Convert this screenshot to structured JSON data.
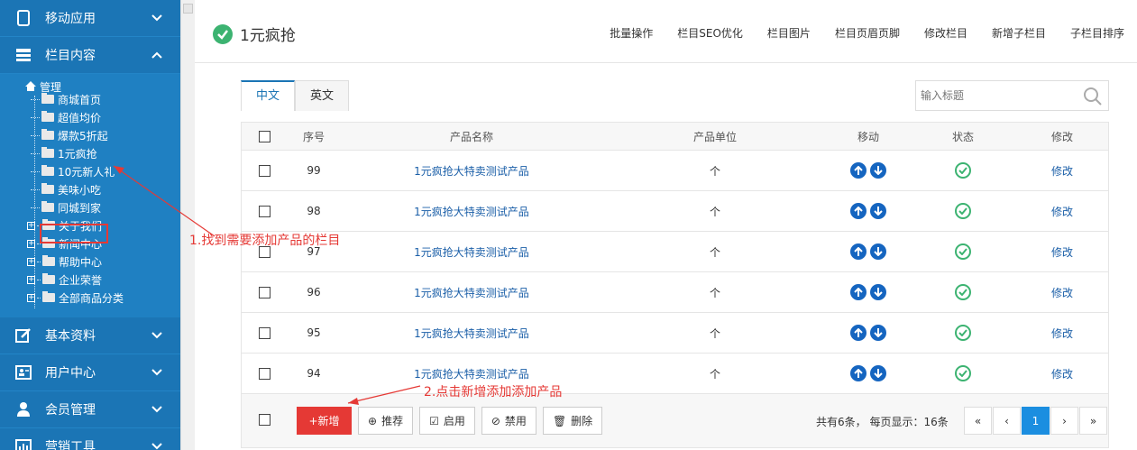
{
  "sidebar": {
    "sections_top": [
      {
        "label": "移动应用",
        "icon": "phone-icon"
      },
      {
        "label": "栏目内容",
        "icon": "columns-icon"
      }
    ],
    "tree_root": "管理",
    "tree_items": [
      "商城首页",
      "超值均价",
      "爆款5折起",
      "1元疯抢",
      "10元新人礼",
      "美味小吃",
      "同城到家",
      "关于我们",
      "新闻中心",
      "帮助中心",
      "企业荣誉",
      "全部商品分类"
    ],
    "sections_bottom": [
      {
        "label": "基本资料",
        "icon": "edit-icon"
      },
      {
        "label": "用户中心",
        "icon": "user-card-icon"
      },
      {
        "label": "会员管理",
        "icon": "person-icon"
      },
      {
        "label": "营销工具",
        "icon": "chart-icon"
      }
    ]
  },
  "header": {
    "title": "1元疯抢",
    "links": [
      "批量操作",
      "栏目SEO优化",
      "栏目图片",
      "栏目页眉页脚",
      "修改栏目",
      "新增子栏目",
      "子栏目排序"
    ]
  },
  "tabs": [
    "中文",
    "英文"
  ],
  "search": {
    "placeholder": "输入标题"
  },
  "table": {
    "headers": [
      "序号",
      "产品名称",
      "产品单位",
      "移动",
      "状态",
      "修改"
    ],
    "rows": [
      {
        "no": "99",
        "name": "1元疯抢大特卖测试产品",
        "unit": "个",
        "edit": "修改"
      },
      {
        "no": "98",
        "name": "1元疯抢大特卖测试产品",
        "unit": "个",
        "edit": "修改"
      },
      {
        "no": "97",
        "name": "1元疯抢大特卖测试产品",
        "unit": "个",
        "edit": "修改"
      },
      {
        "no": "96",
        "name": "1元疯抢大特卖测试产品",
        "unit": "个",
        "edit": "修改"
      },
      {
        "no": "95",
        "name": "1元疯抢大特卖测试产品",
        "unit": "个",
        "edit": "修改"
      },
      {
        "no": "94",
        "name": "1元疯抢大特卖测试产品",
        "unit": "个",
        "edit": "修改"
      }
    ]
  },
  "footer": {
    "buttons": {
      "add": "+新增",
      "recommend": "推荐",
      "enable": "启用",
      "disable": "禁用",
      "delete": "删除"
    },
    "info": "共有6条，  每页显示：16条",
    "pager": {
      "first": "«",
      "prev": "‹",
      "current": "1",
      "next": "›",
      "last": "»"
    }
  },
  "annotations": {
    "a1": "1.找到需要添加产品的栏目",
    "a2": "2.点击新增添加添加产品"
  },
  "colors": {
    "sidebar": "#1b75b5",
    "accent": "#e53935",
    "link": "#1b5fa8",
    "success": "#3cb371"
  }
}
